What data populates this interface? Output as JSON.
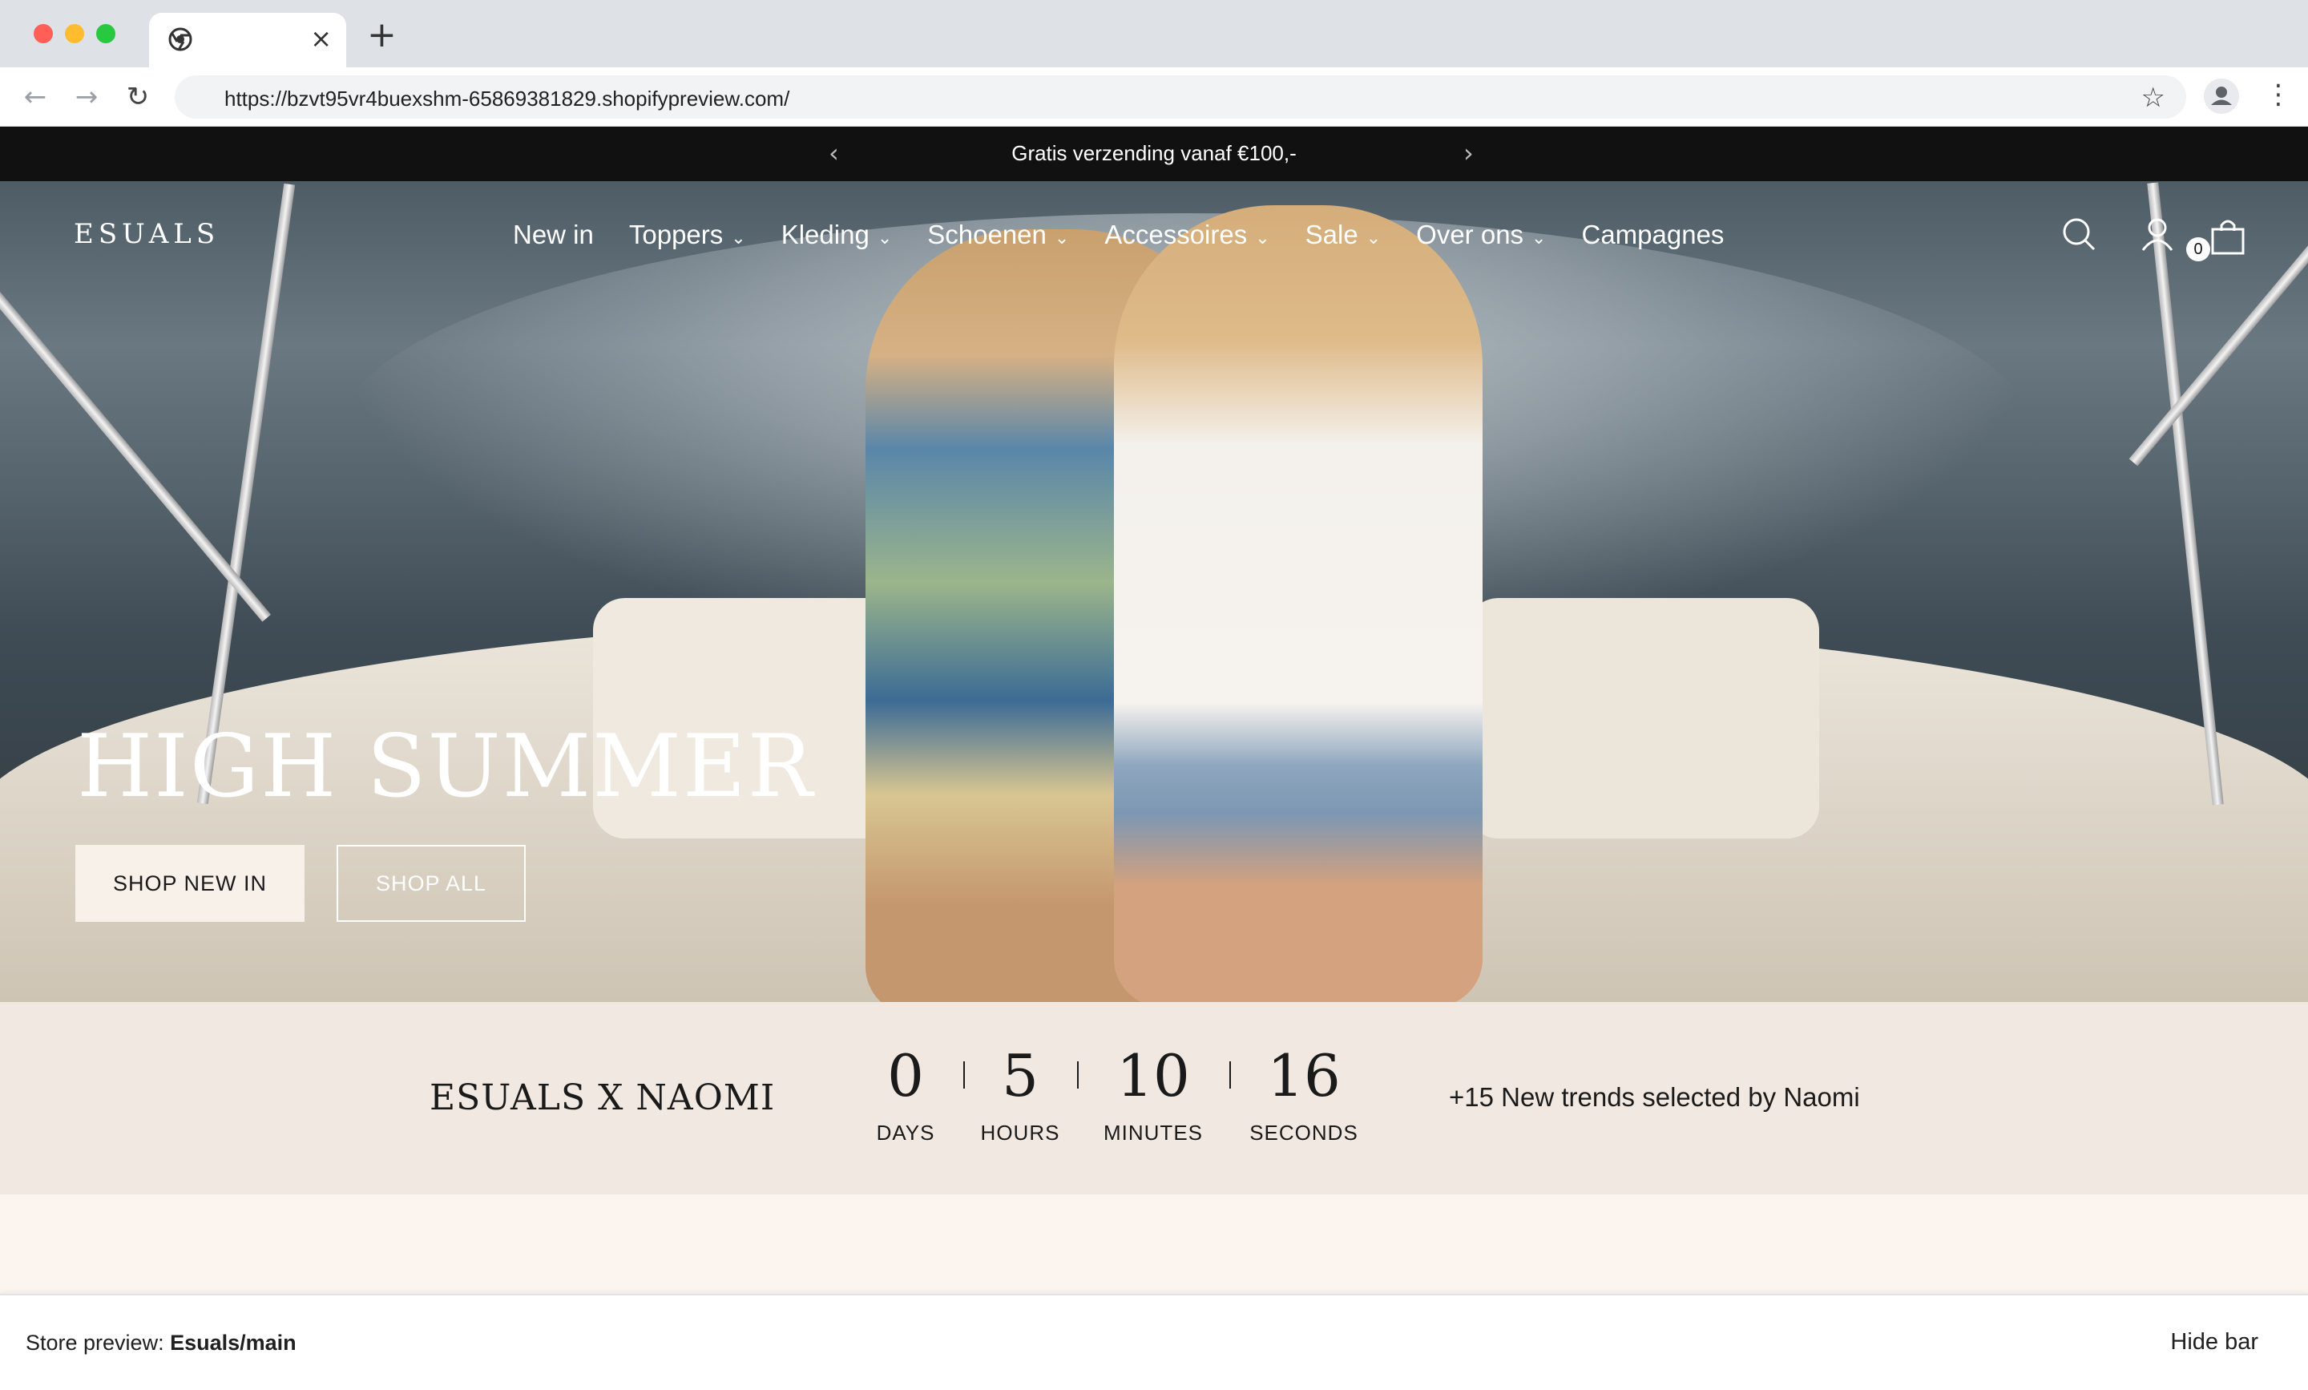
{
  "browser": {
    "tab_close": "×",
    "new_tab": "+",
    "url": "https://bzvt95vr4buexshm-65869381829.shopifypreview.com/",
    "icons": [
      "chrome-icon",
      "back-arrow-icon",
      "forward-arrow-icon",
      "reload-icon",
      "star-icon",
      "profile-icon",
      "menu-dots-icon"
    ]
  },
  "announcement": {
    "text": "Gratis verzending vanaf €100,-",
    "prev": "‹",
    "next": "›"
  },
  "header": {
    "logo": "ESUALS",
    "nav": [
      {
        "label": "New in",
        "chevron": ""
      },
      {
        "label": "Toppers",
        "chevron": "⌄"
      },
      {
        "label": "Kleding",
        "chevron": "⌄"
      },
      {
        "label": "Schoenen",
        "chevron": "⌄"
      },
      {
        "label": "Accessoires",
        "chevron": "⌄"
      },
      {
        "label": "Sale",
        "chevron": "⌄"
      },
      {
        "label": "Over ons",
        "chevron": "⌄"
      },
      {
        "label": "Campagnes",
        "chevron": ""
      }
    ],
    "cart_count": "0",
    "icons": [
      "search-icon",
      "account-icon",
      "cart-icon"
    ]
  },
  "hero": {
    "title": "HIGH SUMMER",
    "primary_button": "SHOP NEW IN",
    "secondary_button": "SHOP ALL"
  },
  "countdown": {
    "title": "ESUALS X NAOMI",
    "days": "0",
    "days_label": "DAYS",
    "hours": "5",
    "hours_label": "HOURS",
    "minutes": "10",
    "minutes_label": "MINUTES",
    "seconds": "16",
    "seconds_label": "SECONDS",
    "tagline": "+15 New trends selected by Naomi"
  },
  "preview_bar": {
    "label": "Store preview:",
    "store": "Esuals/main",
    "hide": "Hide bar"
  },
  "colors": {
    "announcement_bg": "#111111",
    "countdown_bg": "#f0e8e1",
    "button_light": "#f7f1ea"
  }
}
